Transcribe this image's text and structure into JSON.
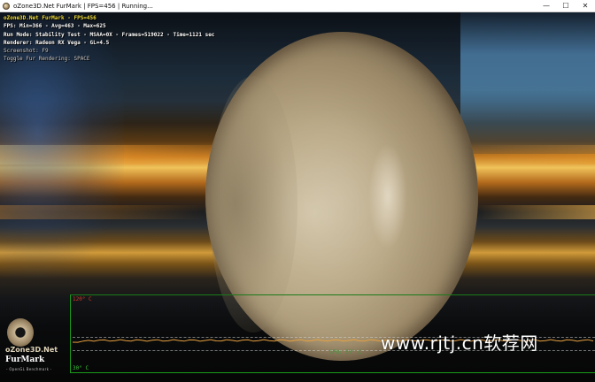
{
  "window": {
    "title": "oZone3D.Net FurMark | FPS=456 | Running...",
    "controls": {
      "minimize": "—",
      "maximize": "☐",
      "close": "✕"
    }
  },
  "osd": {
    "fps_line": "oZone3D.Net FurMark - FPS=456",
    "stats_line": "FPS: Min=366 - Avg=463 - Max=625",
    "run_mode_line": "Run Mode: Stability Test - MSAA=0X - Frames=519022 - Time=1121 sec",
    "renderer_line": "Renderer: Radeon RX Vega - GL=4.5",
    "screenshot_line": "Screenshot: F9",
    "toggle_line": "Toggle Fur Rendering: SPACE"
  },
  "graph": {
    "max_label": "120° C",
    "min_label": "30° C",
    "current_label": "GPU: 55° C",
    "colors": {
      "max": "#d23a2a",
      "min": "#3ac23a",
      "curve": "#e8a040",
      "axis": "#1a9a1a"
    }
  },
  "logo": {
    "line1": "oZone3D.Net",
    "line2": "FurMark",
    "line3": "- OpenGL Benchmark -"
  },
  "watermark": {
    "text": "www.rjtj.cn软荐网"
  }
}
